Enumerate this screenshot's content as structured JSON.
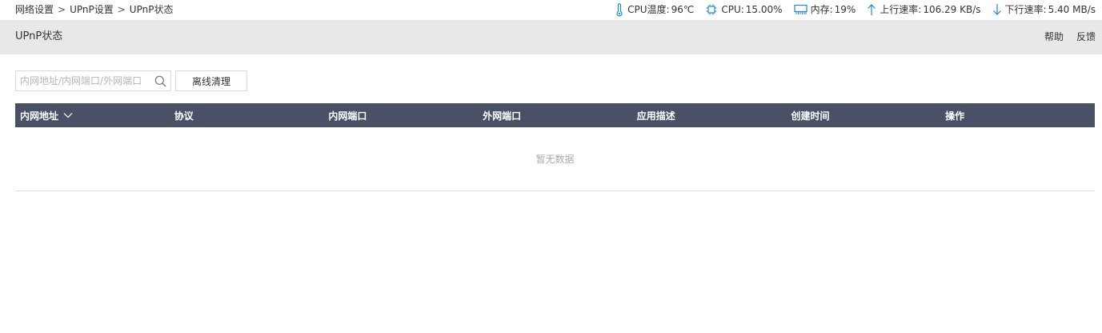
{
  "breadcrumb": {
    "items": [
      "网络设置",
      "UPnP设置",
      "UPnP状态"
    ],
    "separator": ">"
  },
  "stats": {
    "temp": {
      "icon": "thermometer-icon",
      "label": "CPU温度:",
      "value": "96℃"
    },
    "cpu": {
      "icon": "cpu-chip-icon",
      "label": "CPU:",
      "value": "15.00%"
    },
    "memory": {
      "icon": "memory-icon",
      "label": "内存:",
      "value": "19%"
    },
    "upload": {
      "icon": "arrow-up-icon",
      "label": "上行速率:",
      "value": "106.29 KB/s"
    },
    "download": {
      "icon": "arrow-down-icon",
      "label": "下行速率:",
      "value": "5.40 MB/s"
    }
  },
  "header": {
    "title": "UPnP状态",
    "help_label": "帮助",
    "feedback_label": "反馈"
  },
  "toolbar": {
    "search_placeholder": "内网地址/内网端口/外网端口",
    "search_value": "",
    "clear_offline_label": "离线清理"
  },
  "table": {
    "columns": [
      "内网地址",
      "协议",
      "内网端口",
      "外网端口",
      "应用描述",
      "创建时间",
      "操作"
    ],
    "rows": [],
    "empty_text": "暂无数据"
  },
  "colors": {
    "icon_blue": "#1e88d0",
    "table_header_bg": "#4a5166",
    "header_bg": "#e8e8e8"
  }
}
